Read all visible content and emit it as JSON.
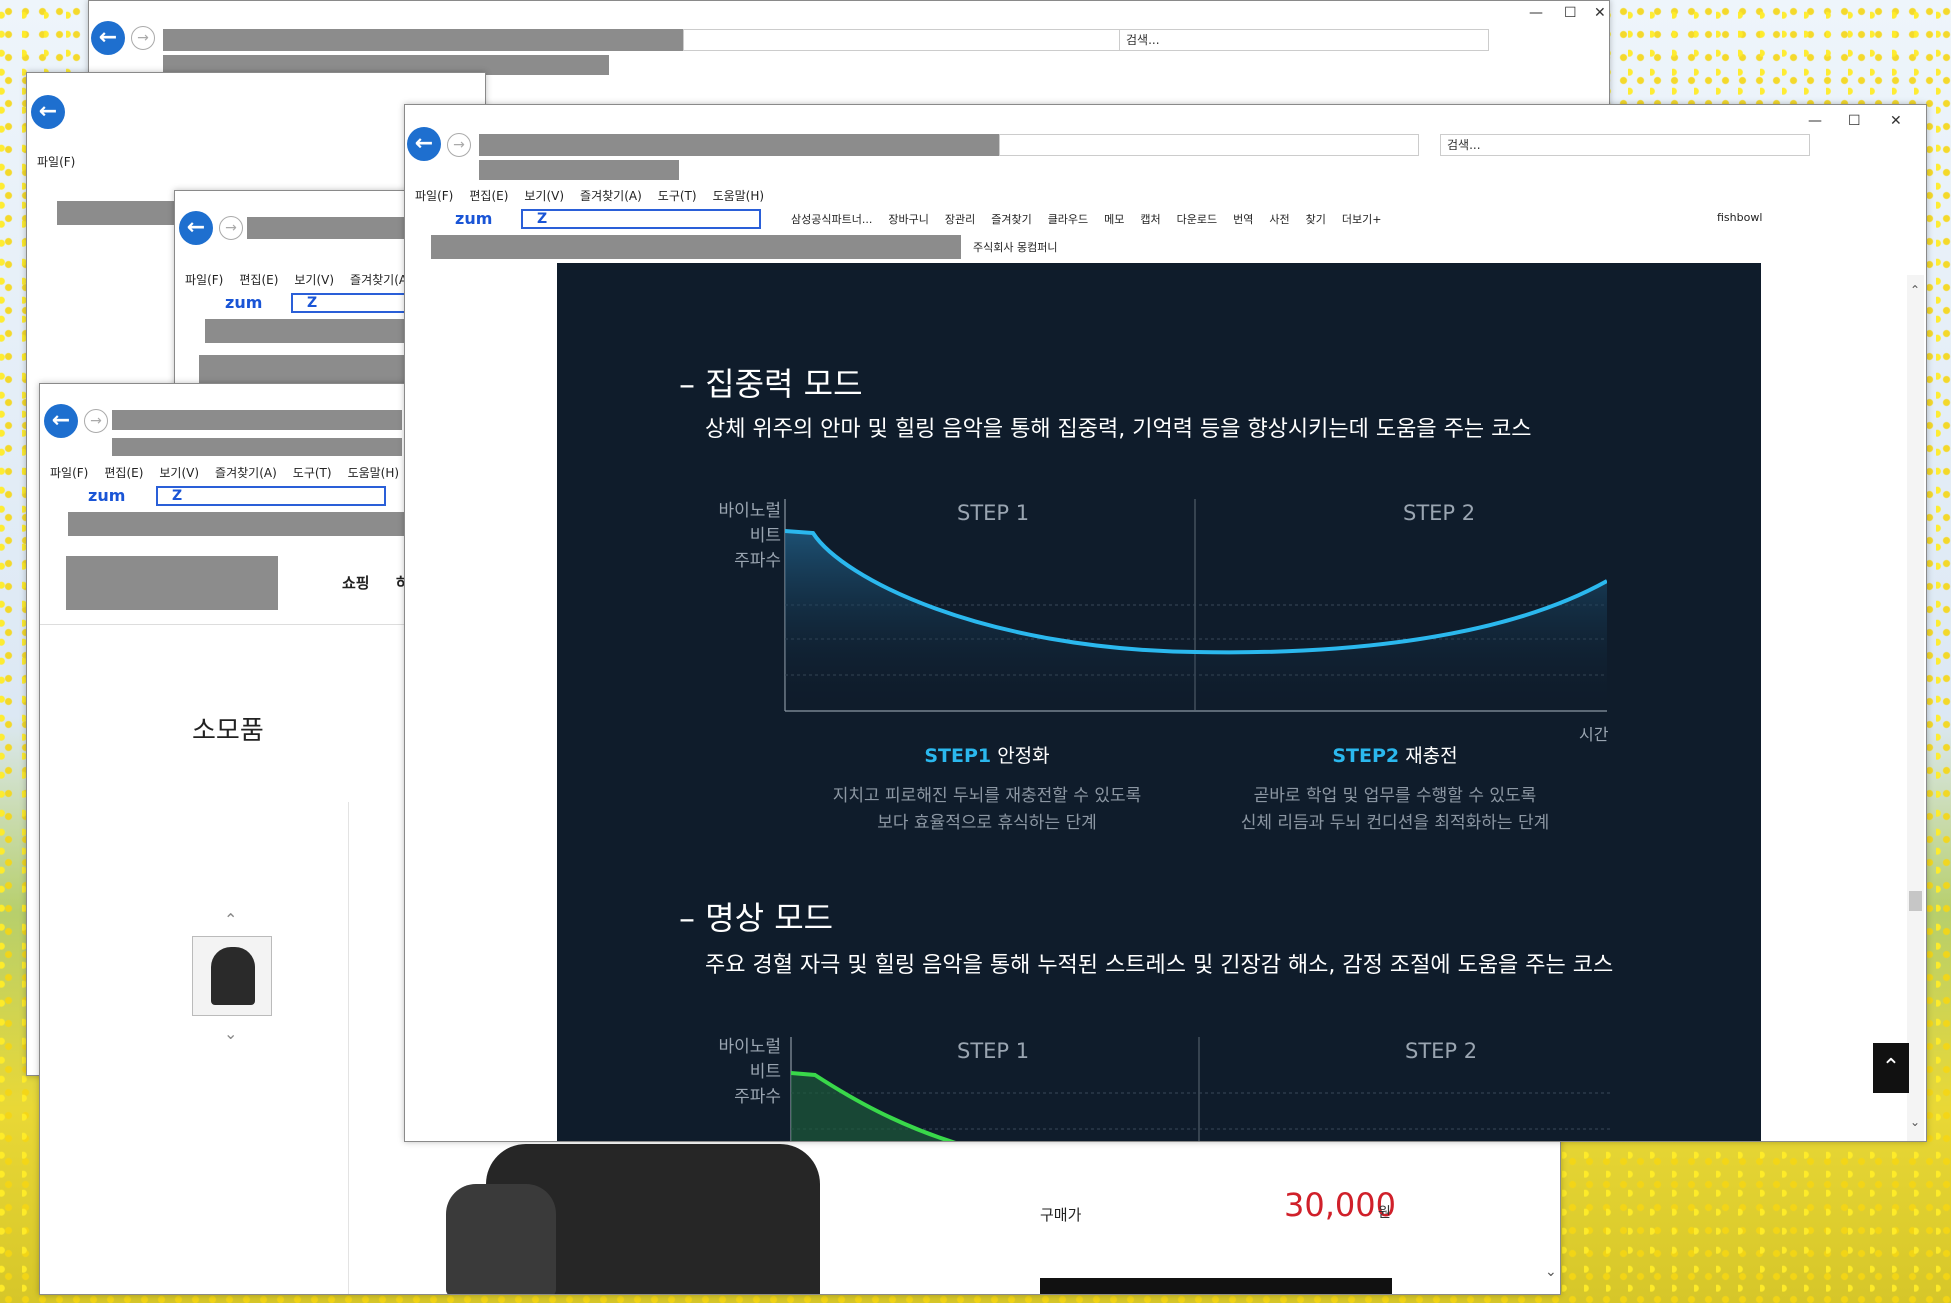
{
  "browser": {
    "menu": [
      "파일(F)",
      "편집(E)",
      "보기(V)",
      "즐겨찾기(A)",
      "도구(T)",
      "도움말(H)"
    ],
    "search_placeholder": "검색...",
    "zum": "zum",
    "zbox": "Z",
    "win_minimize": "—",
    "win_maximize": "☐",
    "win_close": "✕"
  },
  "toolbar": {
    "items": [
      "삼성공식파트너...",
      "장바구니",
      "장관리",
      "즐겨찾기",
      "클라우드",
      "메모",
      "캡처",
      "다운로드",
      "번역",
      "사전",
      "찾기",
      "더보기+"
    ],
    "fishbowl": "fishbowl",
    "favorite": "주식회사 몽컴퍼니"
  },
  "shop": {
    "nav": "쇼핑",
    "nav2": "하",
    "category": "소모품",
    "price_label": "구매가",
    "price": "30,000",
    "currency": "원"
  },
  "content": {
    "mode1": {
      "title": "– 집중력 모드",
      "desc": "상체 위주의 안마 및 힐링 음악을 통해 집중력, 기억력 등을 향상시키는데 도움을 주는 코스",
      "ylabel": [
        "바이노럴",
        "비트",
        "주파수"
      ],
      "xlabel": "시간",
      "step1_title": "STEP 1",
      "step2_title": "STEP 2",
      "step1_label": "STEP1",
      "step1_name": "안정화",
      "step1_desc": [
        "지치고 피로해진 두뇌를 재충전할 수 있도록",
        "보다 효율적으로 휴식하는 단계"
      ],
      "step2_label": "STEP2",
      "step2_name": "재충전",
      "step2_desc": [
        "곧바로 학업 및 업무를 수행할 수 있도록",
        "신체 리듬과 두뇌 컨디션을 최적화하는 단계"
      ]
    },
    "mode2": {
      "title": "– 명상 모드",
      "desc": "주요 경혈 자극 및 힐링 음악을 통해 누적된 스트레스 및 긴장감 해소, 감정 조절에 도움을 주는 코스",
      "ylabel": [
        "바이노럴",
        "비트",
        "주파수"
      ],
      "step1_title": "STEP 1",
      "step2_title": "STEP 2"
    }
  },
  "colors": {
    "dark_bg": "#0f1c2b",
    "cyan": "#2bb8ee",
    "green": "#39d84a",
    "price": "#d0202a"
  }
}
